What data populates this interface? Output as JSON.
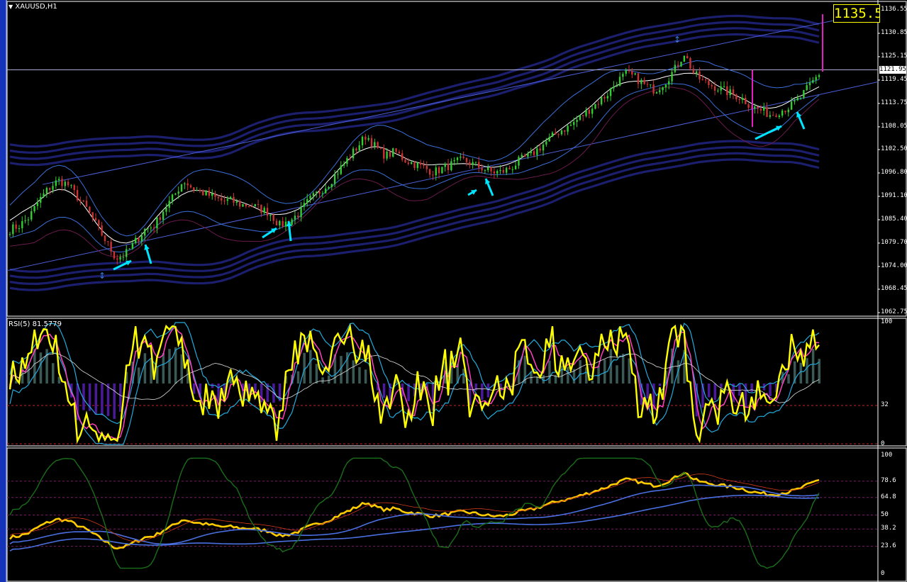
{
  "symbol_title": "XAUUSD,H1",
  "rsi_title": "RSI(5) 81.5779",
  "big_price": "1135.5",
  "current_price_label": "1121.95",
  "colors": {
    "background": "#000000",
    "up_candle": "#33cc33",
    "down_candle": "#cc3333",
    "rsi_line": "#ffff00",
    "channel": "#4a5fd8",
    "envelope": "#1c1f6e",
    "arrow": "#00e5ff",
    "stoch_line": "#ffcc00",
    "green_line": "#1a6e1a"
  },
  "chart_data": [
    {
      "type": "candlestick",
      "title": "XAUUSD,H1",
      "ylim": [
        1062.75,
        1136.55
      ],
      "y_ticks": [
        "1136.55",
        "1130.85",
        "1125.15",
        "1119.45",
        "1113.75",
        "1108.05",
        "1102.50",
        "1096.80",
        "1091.10",
        "1085.40",
        "1079.70",
        "1074.00",
        "1068.45",
        "1062.75"
      ],
      "close_path": [
        1083,
        1084,
        1086,
        1090,
        1093,
        1095,
        1094,
        1091,
        1088,
        1084,
        1080,
        1076,
        1077,
        1080,
        1083,
        1084,
        1088,
        1091,
        1095,
        1093,
        1092,
        1091,
        1090,
        1090,
        1089,
        1089,
        1088,
        1087,
        1084,
        1085,
        1087,
        1090,
        1092,
        1094,
        1097,
        1100,
        1103,
        1106,
        1103,
        1101,
        1102,
        1100,
        1099,
        1098,
        1097,
        1098,
        1099,
        1100,
        1099,
        1098,
        1097,
        1097,
        1098,
        1100,
        1101,
        1103,
        1105,
        1107,
        1108,
        1110,
        1112,
        1114,
        1116,
        1119,
        1121,
        1120,
        1118,
        1117,
        1119,
        1122,
        1126,
        1121,
        1119,
        1118,
        1117,
        1116,
        1115,
        1113,
        1112,
        1111,
        1112,
        1113,
        1115,
        1118,
        1121
      ],
      "current_price": 1121.95,
      "last_tick_price": 1135.5
    },
    {
      "type": "line",
      "title": "RSI(5) 81.5779",
      "ylim": [
        0,
        100
      ],
      "y_ticks": [
        "100",
        "32",
        "0"
      ],
      "level": 32,
      "last_value": 81.5779
    },
    {
      "type": "line",
      "ylim": [
        0,
        100
      ],
      "y_ticks": [
        "100",
        "78.6",
        "64.8",
        "50",
        "38.2",
        "23.6",
        "0"
      ],
      "levels": [
        78.6,
        64.8,
        50,
        38.2,
        23.6
      ]
    }
  ]
}
